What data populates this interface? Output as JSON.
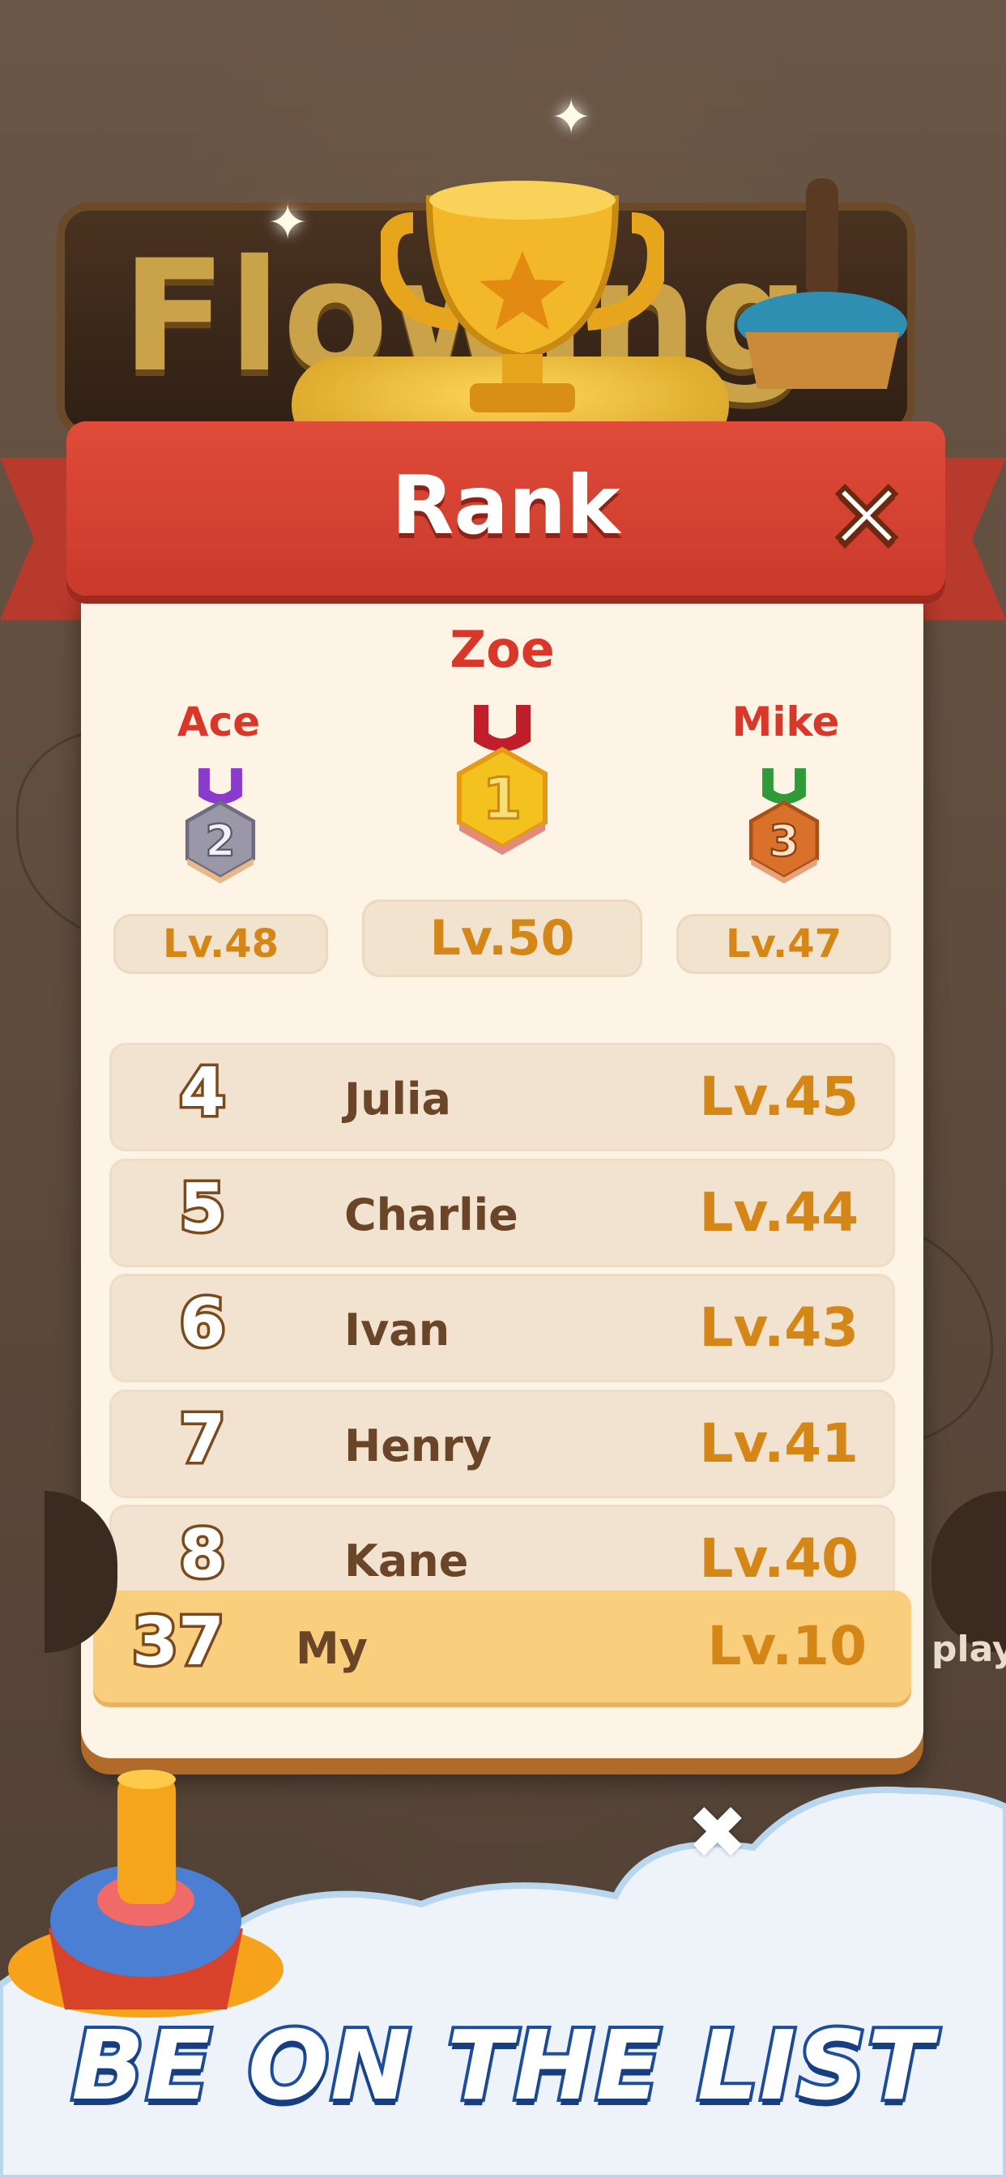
{
  "header": {
    "title": "Rank"
  },
  "close": {
    "symbol": "✕"
  },
  "podium": {
    "first": {
      "name": "Zoe",
      "rank": "1",
      "level": "Lv.50"
    },
    "second": {
      "name": "Ace",
      "rank": "2",
      "level": "Lv.48"
    },
    "third": {
      "name": "Mike",
      "rank": "3",
      "level": "Lv.47"
    }
  },
  "rows": [
    {
      "rank": "4",
      "name": "Julia",
      "level": "Lv.45"
    },
    {
      "rank": "5",
      "name": "Charlie",
      "level": "Lv.44"
    },
    {
      "rank": "6",
      "name": "Ivan",
      "level": "Lv.43"
    },
    {
      "rank": "7",
      "name": "Henry",
      "level": "Lv.41"
    },
    {
      "rank": "8",
      "name": "Kane",
      "level": "Lv.40"
    }
  ],
  "my_row": {
    "rank": "37",
    "name": "My",
    "level": "Lv.10"
  },
  "background": {
    "logo_text": "Flowing",
    "side_label": "play"
  },
  "tagline": "BE ON THE LIST",
  "colors": {
    "header_red": "#d9412f",
    "level_gold": "#d48617",
    "panel": "#fdf4e6",
    "my_row": "#f9cf7e"
  }
}
